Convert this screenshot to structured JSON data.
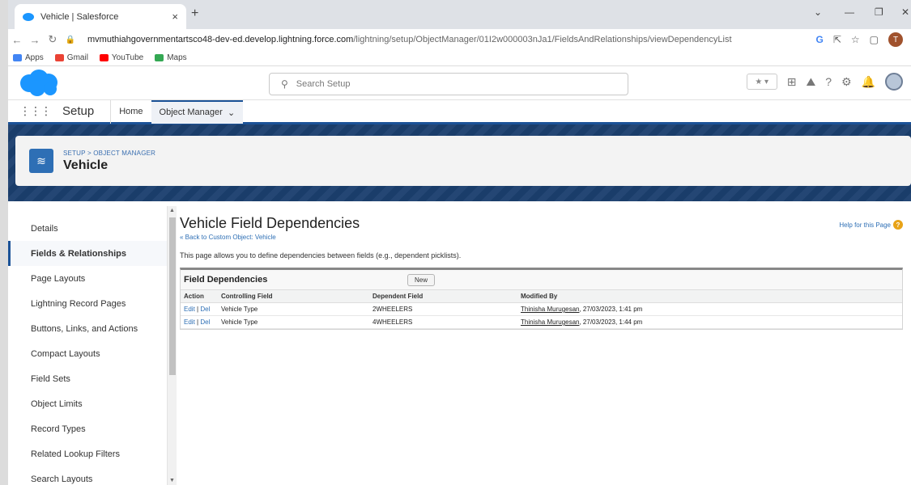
{
  "browser": {
    "tab_title": "Vehicle | Salesforce",
    "tab_close": "×",
    "new_tab": "+",
    "url_host": "mvmuthiahgovernmentartsco48-dev-ed.develop.lightning.force.com",
    "url_path": "/lightning/setup/ObjectManager/01I2w000003nJa1/FieldsAndRelationships/viewDependencyList",
    "profile_initial": "T",
    "bookmarks": [
      {
        "label": "Apps",
        "color": "#4285f4"
      },
      {
        "label": "Gmail",
        "color": "#ea4335"
      },
      {
        "label": "YouTube",
        "color": "#ff0000"
      },
      {
        "label": "Maps",
        "color": "#34a853"
      }
    ]
  },
  "header": {
    "search_placeholder": "Search Setup"
  },
  "appnav": {
    "app_name": "Setup",
    "home": "Home",
    "object_manager": "Object Manager"
  },
  "banner": {
    "breadcrumb": "SETUP > OBJECT MANAGER",
    "object_name": "Vehicle"
  },
  "sidebar": {
    "items": [
      {
        "label": "Details"
      },
      {
        "label": "Fields & Relationships"
      },
      {
        "label": "Page Layouts"
      },
      {
        "label": "Lightning Record Pages"
      },
      {
        "label": "Buttons, Links, and Actions"
      },
      {
        "label": "Compact Layouts"
      },
      {
        "label": "Field Sets"
      },
      {
        "label": "Object Limits"
      },
      {
        "label": "Record Types"
      },
      {
        "label": "Related Lookup Filters"
      },
      {
        "label": "Search Layouts"
      }
    ]
  },
  "main": {
    "title": "Vehicle Field Dependencies",
    "back_link": "« Back to Custom Object: Vehicle",
    "help_link": "Help for this Page",
    "description": "This page allows you to define dependencies between fields (e.g., dependent picklists).",
    "panel_title": "Field Dependencies",
    "new_button": "New",
    "columns": [
      "Action",
      "Controlling Field",
      "Dependent Field",
      "Modified By"
    ],
    "rows": [
      {
        "edit": "Edit",
        "sep": " | ",
        "del": "Del",
        "controlling": "Vehicle Type",
        "dependent": "2WHEELERS",
        "modified_by": "Thinisha Murugesan",
        "modified_at": ", 27/03/2023, 1:41 pm"
      },
      {
        "edit": "Edit",
        "sep": " | ",
        "del": "Del",
        "controlling": "Vehicle Type",
        "dependent": "4WHEELERS",
        "modified_by": "Thinisha Murugesan",
        "modified_at": ", 27/03/2023, 1:44 pm"
      }
    ]
  }
}
